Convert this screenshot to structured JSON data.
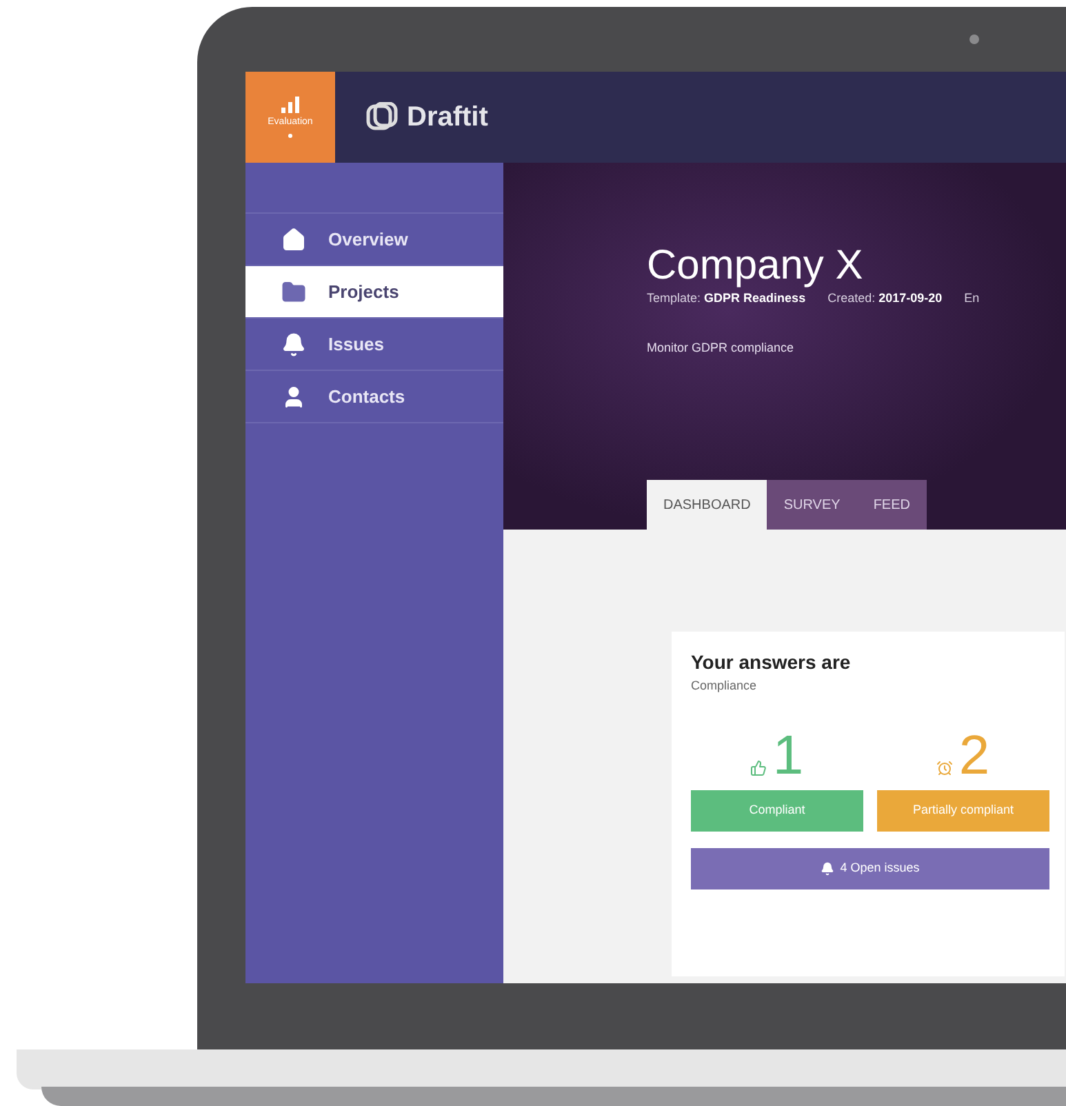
{
  "app": {
    "module_label": "Evaluation",
    "logo_text": "Draftit"
  },
  "sidebar": {
    "items": [
      {
        "label": "Overview",
        "kind": "home",
        "selected": false
      },
      {
        "label": "Projects",
        "kind": "folder",
        "selected": true
      },
      {
        "label": "Issues",
        "kind": "bell",
        "selected": false
      },
      {
        "label": "Contacts",
        "kind": "user",
        "selected": false
      }
    ]
  },
  "header": {
    "title": "Company X",
    "meta": [
      {
        "label": "Template:",
        "value": "GDPR Readiness"
      },
      {
        "label": "Created:",
        "value": "2017-09-20"
      },
      {
        "label": "En"
      }
    ],
    "description": "Monitor GDPR compliance"
  },
  "tabs": [
    {
      "label": "DASHBOARD",
      "selected": true
    },
    {
      "label": "SURVEY",
      "selected": false
    },
    {
      "label": "FEED",
      "selected": false
    }
  ],
  "card": {
    "title": "Your answers are",
    "subtitle": "Compliance",
    "stats": [
      {
        "count": "1",
        "label": "Compliant",
        "kind": "thumbs-up",
        "color": "#5cbd7e"
      },
      {
        "count": "2",
        "label": "Partially compliant",
        "kind": "alarm",
        "color": "#eaa83a"
      }
    ],
    "issues_button": "4 Open issues"
  }
}
